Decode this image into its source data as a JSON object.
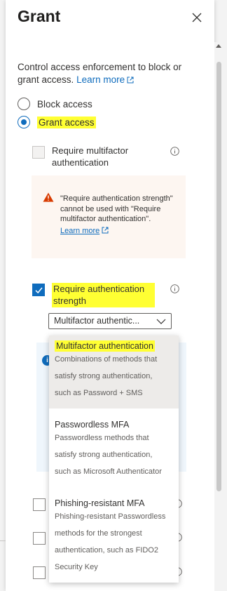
{
  "panel": {
    "title": "Grant"
  },
  "description": {
    "text": "Control access enforcement to block or grant access.",
    "learn_more": "Learn more"
  },
  "access": {
    "block_label": "Block access",
    "grant_label": "Grant access"
  },
  "controls": {
    "mfa_label": "Require multifactor authentication",
    "auth_strength_label": "Require authentication strength"
  },
  "warning": {
    "text": "\"Require authentication strength\" cannot be used with \"Require multifactor authentication\".",
    "learn_more": "Learn more"
  },
  "dropdown": {
    "selected": "Multifactor authentic...",
    "options": [
      {
        "title": "Multifactor authentication",
        "desc": [
          "Combinations of methods that",
          "satisfy strong authentication,",
          "such as Password + SMS"
        ]
      },
      {
        "title": "Passwordless MFA",
        "desc": [
          "Passwordless methods that",
          "satisfy strong authentication,",
          "such as Microsoft Authenticator"
        ]
      },
      {
        "title": "Phishing-resistant MFA",
        "desc": [
          "Phishing-resistant Passwordless",
          "methods for the strongest",
          "authentication, such as FIDO2",
          "Security Key"
        ]
      }
    ]
  },
  "info_box": {
    "icon_letter": "i"
  },
  "colors": {
    "accent": "#0f6cbd",
    "highlight": "#ffff33",
    "warning": "#d83b01"
  }
}
